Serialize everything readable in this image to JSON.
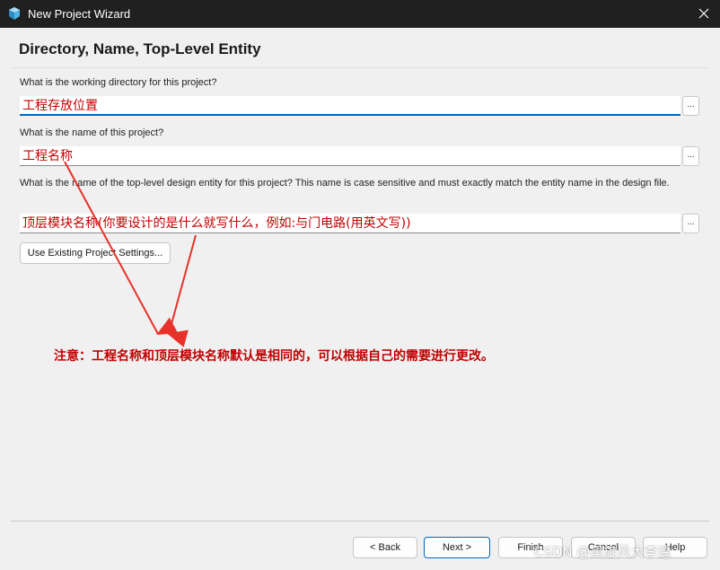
{
  "window": {
    "title": "New Project Wizard",
    "close_icon": "close-icon",
    "app_icon": "quartus-app-icon"
  },
  "page": {
    "heading": "Directory, Name, Top-Level Entity"
  },
  "fields": {
    "directory": {
      "question": "What is the working directory for this project?",
      "value": "工程存放位置",
      "browse_label": "..."
    },
    "name": {
      "question": "What is the name of this project?",
      "value": "工程名称",
      "browse_label": "..."
    },
    "entity": {
      "question": "What is the name of the top-level design entity for this project? This name is case sensitive and must exactly match the entity name in the design file.",
      "value": "顶层模块名称(你要设计的是什么就写什么，例如:与门电路(用英文写))",
      "browse_label": "..."
    }
  },
  "use_existing_button": "Use Existing Project Settings...",
  "annotation": {
    "note": "注意：工程名称和顶层模块名称默认是相同的，可以根据自己的需要进行更改。",
    "color": "#c00000"
  },
  "footer": {
    "back": "< Back",
    "next": "Next >",
    "finish": "Finish",
    "cancel": "Cancel",
    "help": "Help"
  },
  "watermark": "CSDN @黑旋风大李逵",
  "colors": {
    "titlebar": "#202020",
    "accent": "#0067c0",
    "annotation_red": "#c00000",
    "background": "#f0f0f0"
  }
}
